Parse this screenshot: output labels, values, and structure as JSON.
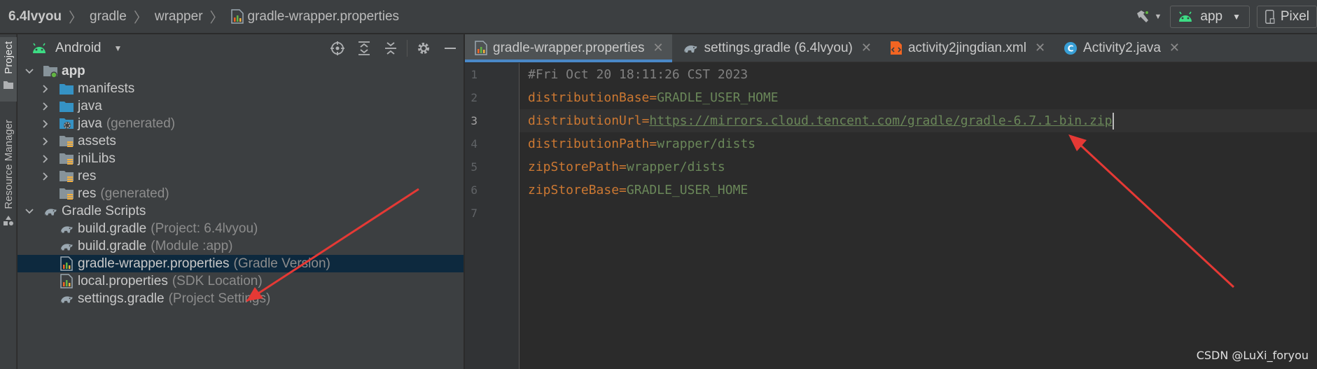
{
  "breadcrumb": {
    "items": [
      "6.4lvyou",
      "gradle",
      "wrapper",
      "gradle-wrapper.properties"
    ]
  },
  "toolbar": {
    "run_config": "app",
    "device": "Pixel",
    "build_icon": "hammer-icon"
  },
  "tool_strip": {
    "project_tab": "Project",
    "resource_tab": "Resource Manager"
  },
  "project_panel": {
    "view_mode": "Android",
    "tools": [
      "locate-icon",
      "expand-all-icon",
      "collapse-all-icon",
      "gear-icon",
      "minimize-icon"
    ],
    "tree": [
      {
        "label": "app",
        "hint": "",
        "depth": 0,
        "expanded": true,
        "icon": "module-folder-icon"
      },
      {
        "label": "manifests",
        "hint": "",
        "depth": 1,
        "expanded": false,
        "icon": "folder-icon"
      },
      {
        "label": "java",
        "hint": "",
        "depth": 1,
        "expanded": false,
        "icon": "folder-icon"
      },
      {
        "label": "java",
        "hint": "(generated)",
        "depth": 1,
        "expanded": false,
        "icon": "generated-folder-icon"
      },
      {
        "label": "assets",
        "hint": "",
        "depth": 1,
        "expanded": false,
        "icon": "resource-folder-icon"
      },
      {
        "label": "jniLibs",
        "hint": "",
        "depth": 1,
        "expanded": false,
        "icon": "resource-folder-icon"
      },
      {
        "label": "res",
        "hint": "",
        "depth": 1,
        "expanded": false,
        "icon": "resource-folder-icon"
      },
      {
        "label": "res",
        "hint": "(generated)",
        "depth": 1,
        "expanded": null,
        "icon": "resource-folder-icon"
      },
      {
        "label": "Gradle Scripts",
        "hint": "",
        "depth": 0,
        "expanded": true,
        "icon": "gradle-icon"
      },
      {
        "label": "build.gradle",
        "hint": "(Project: 6.4lvyou)",
        "depth": 1,
        "expanded": null,
        "icon": "gradle-icon"
      },
      {
        "label": "build.gradle",
        "hint": "(Module :app)",
        "depth": 1,
        "expanded": null,
        "icon": "gradle-icon"
      },
      {
        "label": "gradle-wrapper.properties",
        "hint": "(Gradle Version)",
        "depth": 1,
        "expanded": null,
        "icon": "properties-file-icon",
        "selected": true
      },
      {
        "label": "local.properties",
        "hint": "(SDK Location)",
        "depth": 1,
        "expanded": null,
        "icon": "properties-file-icon"
      },
      {
        "label": "settings.gradle",
        "hint": "(Project Settings)",
        "depth": 1,
        "expanded": null,
        "icon": "gradle-icon"
      }
    ]
  },
  "editor": {
    "tabs": [
      {
        "label": "gradle-wrapper.properties",
        "icon": "properties-file-icon",
        "active": true
      },
      {
        "label": "settings.gradle (6.4lvyou)",
        "icon": "gradle-icon",
        "active": false
      },
      {
        "label": "activity2jingdian.xml",
        "icon": "xml-file-icon",
        "active": false
      },
      {
        "label": "Activity2.java",
        "icon": "java-class-icon",
        "active": false
      }
    ],
    "current_line": 3,
    "lines": [
      {
        "no": "1",
        "comment": "#Fri Oct 20 18:11:26 CST 2023"
      },
      {
        "no": "2",
        "key": "distributionBase",
        "value": "GRADLE_USER_HOME"
      },
      {
        "no": "3",
        "key": "distributionUrl",
        "value": "https://mirrors.cloud.tencent.com/gradle/gradle-6.7.1-bin.zip",
        "url": true
      },
      {
        "no": "4",
        "key": "distributionPath",
        "value": "wrapper/dists"
      },
      {
        "no": "5",
        "key": "zipStorePath",
        "value": "wrapper/dists"
      },
      {
        "no": "6",
        "key": "zipStoreBase",
        "value": "GRADLE_USER_HOME"
      },
      {
        "no": "7"
      }
    ]
  },
  "watermark": "CSDN @LuXi_foryou",
  "colors": {
    "annotation_arrow": "#e53935",
    "selection": "#0d293e",
    "tab_accent": "#4a88c7",
    "key": "#cc7832",
    "value": "#6a8759"
  }
}
